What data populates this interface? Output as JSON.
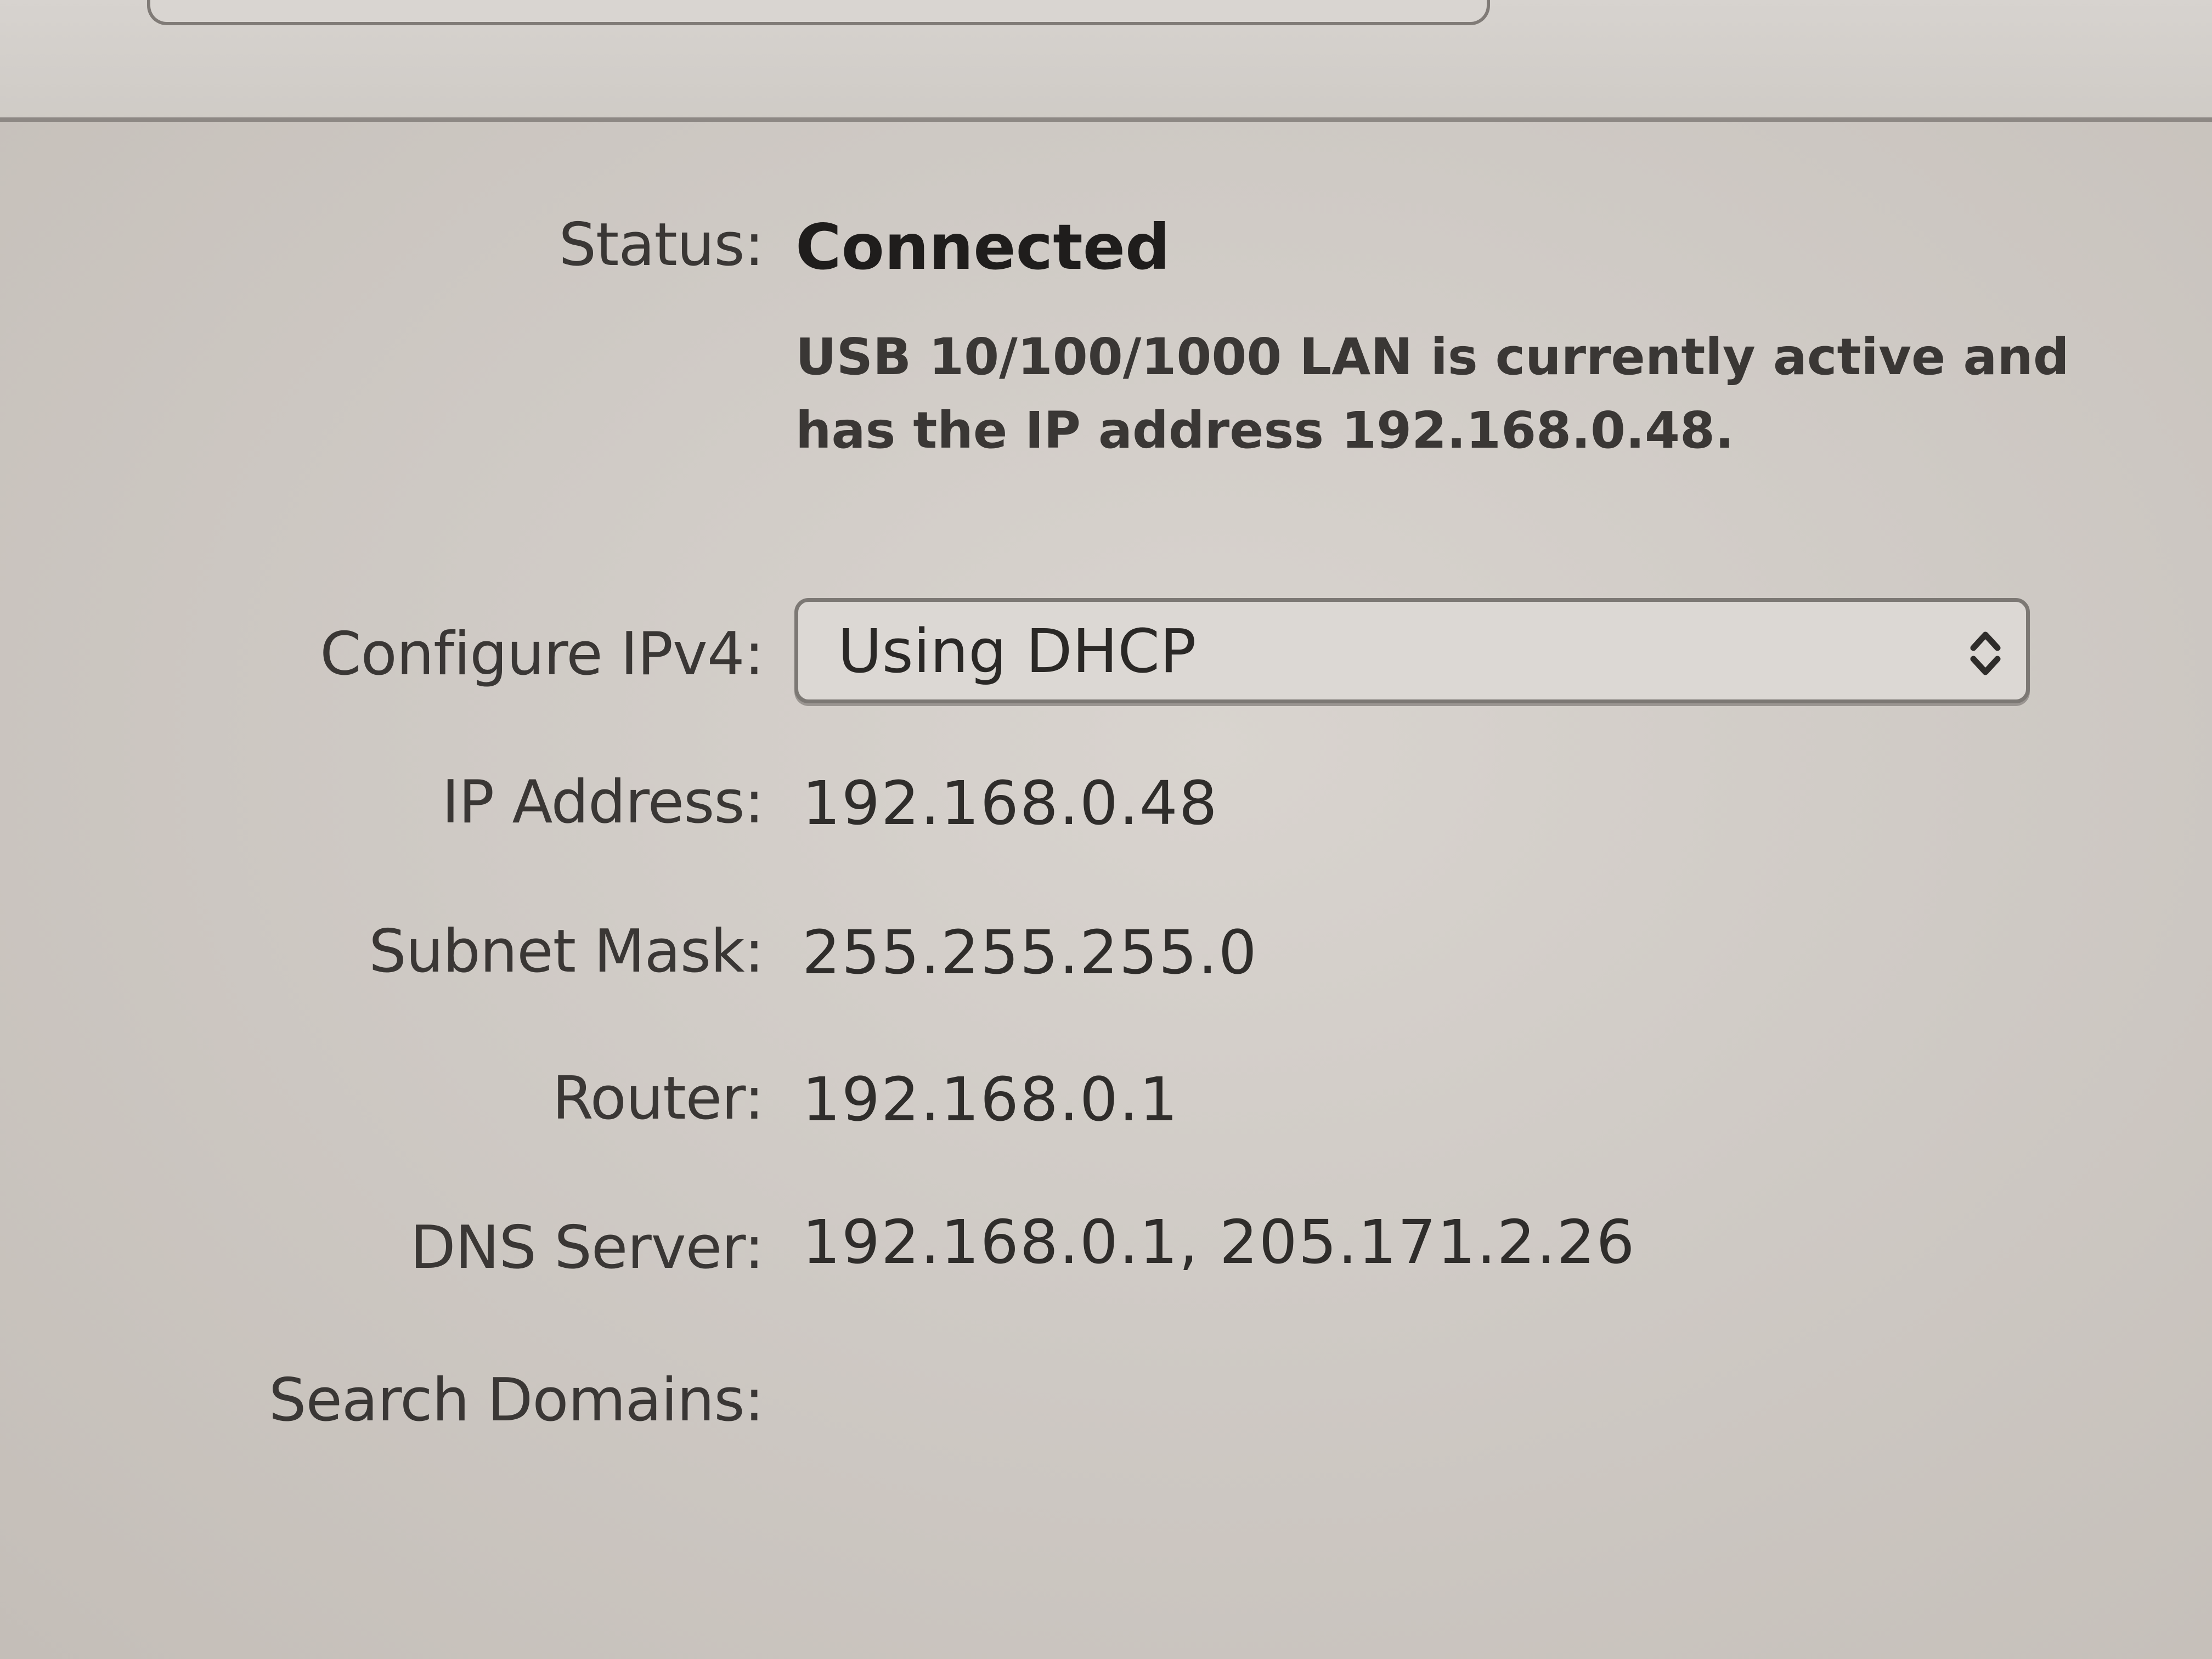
{
  "network": {
    "status_label": "Status:",
    "status_value": "Connected",
    "status_description_line1": "USB 10/100/1000 LAN is currently active and",
    "status_description_line2": "has the IP address 192.168.0.48.",
    "configure_label": "Configure IPv4:",
    "configure_value": "Using DHCP",
    "ip_label": "IP Address:",
    "ip_value": "192.168.0.48",
    "subnet_label": "Subnet Mask:",
    "subnet_value": "255.255.255.0",
    "router_label": "Router:",
    "router_value": "192.168.0.1",
    "dns_label": "DNS Server:",
    "dns_value": "192.168.0.1, 205.171.2.26",
    "search_label": "Search Domains:",
    "search_value": ""
  },
  "icons": {
    "select": "chevron-up-down-icon"
  }
}
